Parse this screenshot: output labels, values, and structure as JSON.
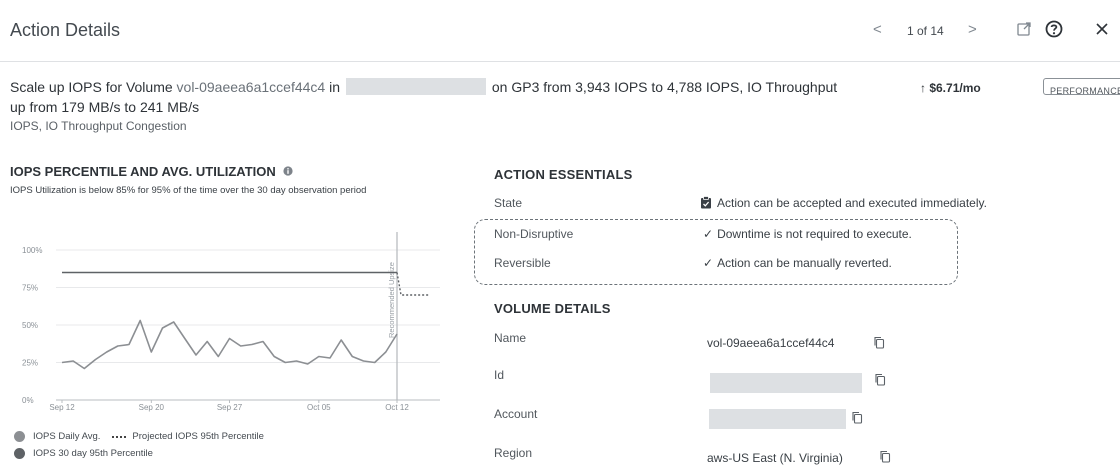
{
  "header": {
    "title": "Action Details",
    "pager_text": "1 of 14",
    "prev_glyph": "<",
    "next_glyph": ">"
  },
  "summary": {
    "line1_prefix": "Scale up IOPS for Volume",
    "volume_id": "vol-09aeea6a1ccef44c4",
    "line1_in": "in",
    "line1_suffix": "on GP3 from 3,943 IOPS to 4,788 IOPS, IO Throughput",
    "cost": "↑ $6.71/mo",
    "badge": "PERFORMANCE",
    "line2": "up from 179 MB/s to 241 MB/s",
    "subcategory": "IOPS, IO Throughput Congestion"
  },
  "chart_section": {
    "title": "IOPS PERCENTILE AND AVG. UTILIZATION",
    "description": "IOPS Utilization is below 85% for 95% of the time over the 30 day observation period"
  },
  "chart_data": {
    "type": "line",
    "x_ticks": [
      "Sep 12",
      "Sep 20",
      "Sep 27",
      "Oct 05",
      "Oct 12"
    ],
    "y_ticks": [
      "0%",
      "25%",
      "50%",
      "75%",
      "100%"
    ],
    "ylim": [
      0,
      100
    ],
    "marker_label": "Recommended Upsize",
    "series": [
      {
        "name": "IOPS Daily Avg.",
        "color": "#8c8f93",
        "x": [
          "Sep 12",
          "Sep 13",
          "Sep 14",
          "Sep 15",
          "Sep 16",
          "Sep 17",
          "Sep 18",
          "Sep 19",
          "Sep 20",
          "Sep 21",
          "Sep 22",
          "Sep 23",
          "Sep 24",
          "Sep 25",
          "Sep 26",
          "Sep 27",
          "Sep 28",
          "Sep 29",
          "Sep 30",
          "Oct 01",
          "Oct 02",
          "Oct 03",
          "Oct 04",
          "Oct 05",
          "Oct 06",
          "Oct 07",
          "Oct 08",
          "Oct 09",
          "Oct 10",
          "Oct 11",
          "Oct 12"
        ],
        "values": [
          25,
          26,
          21,
          27,
          32,
          36,
          37,
          53,
          32,
          48,
          52,
          41,
          30,
          39,
          29,
          41,
          36,
          37,
          39,
          29,
          25,
          26,
          24,
          29,
          28,
          40,
          29,
          26,
          25,
          32,
          44
        ]
      },
      {
        "name": "IOPS 30 day 95th Percentile",
        "color": "#5e6266",
        "values": [
          85,
          85
        ]
      },
      {
        "name": "Projected IOPS 95th Percentile",
        "color": "#5e6266",
        "values": [
          85,
          70
        ]
      }
    ]
  },
  "essentials": {
    "title": "ACTION ESSENTIALS",
    "rows": [
      {
        "label": "State",
        "value": "Action can be accepted and executed immediately."
      },
      {
        "label": "Non-Disruptive",
        "value": "Downtime is not required to execute."
      },
      {
        "label": "Reversible",
        "value": "Action can be manually reverted."
      }
    ]
  },
  "volume": {
    "title": "VOLUME DETAILS",
    "rows": [
      {
        "label": "Name",
        "value": "vol-09aeea6a1ccef44c4"
      },
      {
        "label": "Id",
        "value": ""
      },
      {
        "label": "Account",
        "value": ""
      },
      {
        "label": "Region",
        "value": "aws-US East (N. Virginia)"
      }
    ]
  }
}
